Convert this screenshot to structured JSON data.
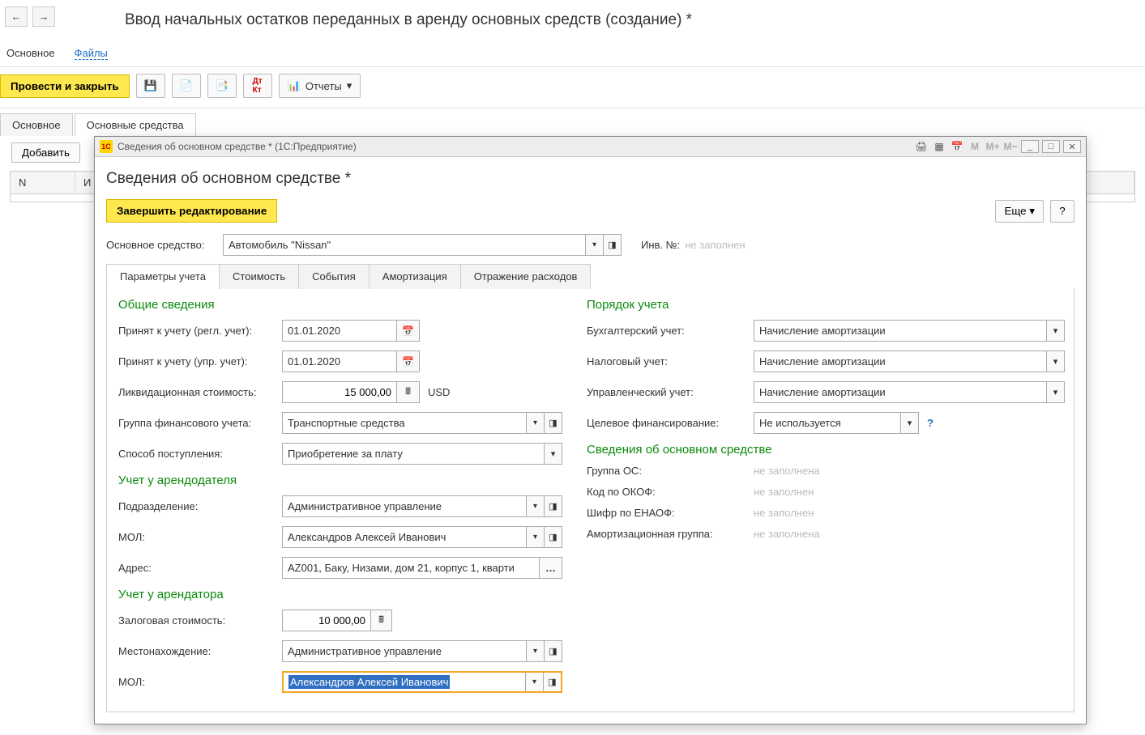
{
  "top_nav": {
    "back_icon": "←",
    "forward_icon": "→"
  },
  "main_title": "Ввод начальных остатков переданных в аренду основных средств (создание) *",
  "sub_tabs": {
    "main": "Основное",
    "files": "Файлы"
  },
  "main_toolbar": {
    "post_close": "Провести и закрыть",
    "reports": "Отчеты"
  },
  "lower_tabs": {
    "main": "Основное",
    "assets": "Основные средства"
  },
  "grid": {
    "add": "Добавить",
    "col_n": "N",
    "col_inv": "И"
  },
  "dialog": {
    "window_title": "Сведения об основном средстве *  (1С:Предприятие)",
    "heading": "Сведения об основном средстве *",
    "finish_edit": "Завершить редактирование",
    "more": "Еще",
    "label_main_asset": "Основное средство:",
    "main_asset_value": "Автомобиль \"Nissan\"",
    "label_inv_num": "Инв. №:",
    "inv_num_placeholder": "не заполнен",
    "tabs": {
      "params": "Параметры учета",
      "cost": "Стоимость",
      "events": "События",
      "amort": "Амортизация",
      "expenses": "Отражение расходов"
    },
    "left": {
      "general_title": "Общие сведения",
      "accept_regl": "Принят к учету (регл. учет):",
      "accept_regl_date": "01.01.2020",
      "accept_mgr": "Принят к учету (упр. учет):",
      "accept_mgr_date": "01.01.2020",
      "liquid": "Ликвидационная стоимость:",
      "liquid_value": "15 000,00",
      "currency": "USD",
      "fin_group": "Группа финансового учета:",
      "fin_group_value": "Транспортные средства",
      "way": "Способ поступления:",
      "way_value": "Приобретение за плату",
      "lessor_title": "Учет у арендодателя",
      "subdiv": "Подразделение:",
      "subdiv_value": "Административное управление",
      "mol": "МОЛ:",
      "mol_value": "Александров Алексей Иванович",
      "address": "Адрес:",
      "address_value": "AZ001, Баку, Низами, дом 21, корпус 1, кварти",
      "lessee_title": "Учет у арендатора",
      "pledge": "Залоговая стоимость:",
      "pledge_value": "10 000,00",
      "location": "Местонахождение:",
      "location_value": "Административное управление",
      "mol2": "МОЛ:",
      "mol2_value": "Александров Алексей Иванович"
    },
    "right": {
      "order_title": "Порядок учета",
      "acc": "Бухгалтерский учет:",
      "acc_value": "Начисление амортизации",
      "tax": "Налоговый учет:",
      "tax_value": "Начисление амортизации",
      "mgr": "Управленческий учет:",
      "mgr_value": "Начисление амортизации",
      "target_fin": "Целевое финансирование:",
      "target_fin_value": "Не используется",
      "info_title": "Сведения об основном средстве",
      "group_os": "Группа ОС:",
      "group_os_ph": "не заполнена",
      "okof": "Код по ОКОФ:",
      "okof_ph": "не заполнен",
      "enaof": "Шифр по ЕНАОФ:",
      "enaof_ph": "не заполнен",
      "amort_group": "Амортизационная группа:",
      "amort_group_ph": "не заполнена"
    }
  }
}
